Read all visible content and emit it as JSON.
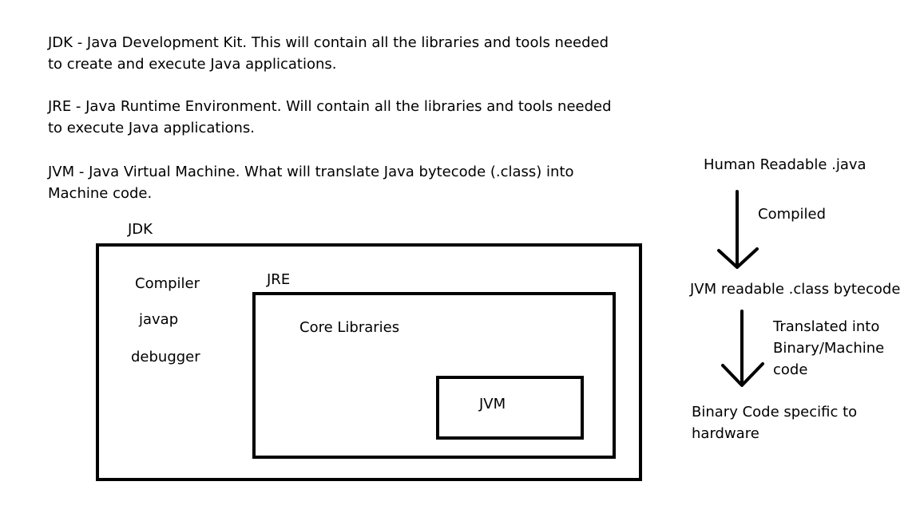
{
  "definitions": {
    "jdk": {
      "line1": "JDK - Java Development Kit. This will contain all the libraries and tools needed",
      "line2": "to create and execute Java applications."
    },
    "jre": {
      "line1": "JRE - Java Runtime Environment. Will contain all the libraries and tools needed",
      "line2": "to execute Java applications."
    },
    "jvm": {
      "line1": "JVM - Java Virtual Machine. What will translate Java bytecode (.class) into",
      "line2": "Machine code."
    }
  },
  "box_diagram": {
    "jdk_label": "JDK",
    "jdk_tools": [
      "Compiler",
      "javap",
      "debugger"
    ],
    "jre_label": "JRE",
    "core_libraries_label": "Core Libraries",
    "jvm_label": "JVM"
  },
  "flow": {
    "source": "Human Readable .java",
    "step1_label": "Compiled",
    "bytecode": "JVM readable .class bytecode",
    "step2_label_lines": [
      "Translated into",
      "Binary/Machine",
      "code"
    ],
    "output_lines": [
      "Binary Code specific to",
      "hardware"
    ]
  }
}
